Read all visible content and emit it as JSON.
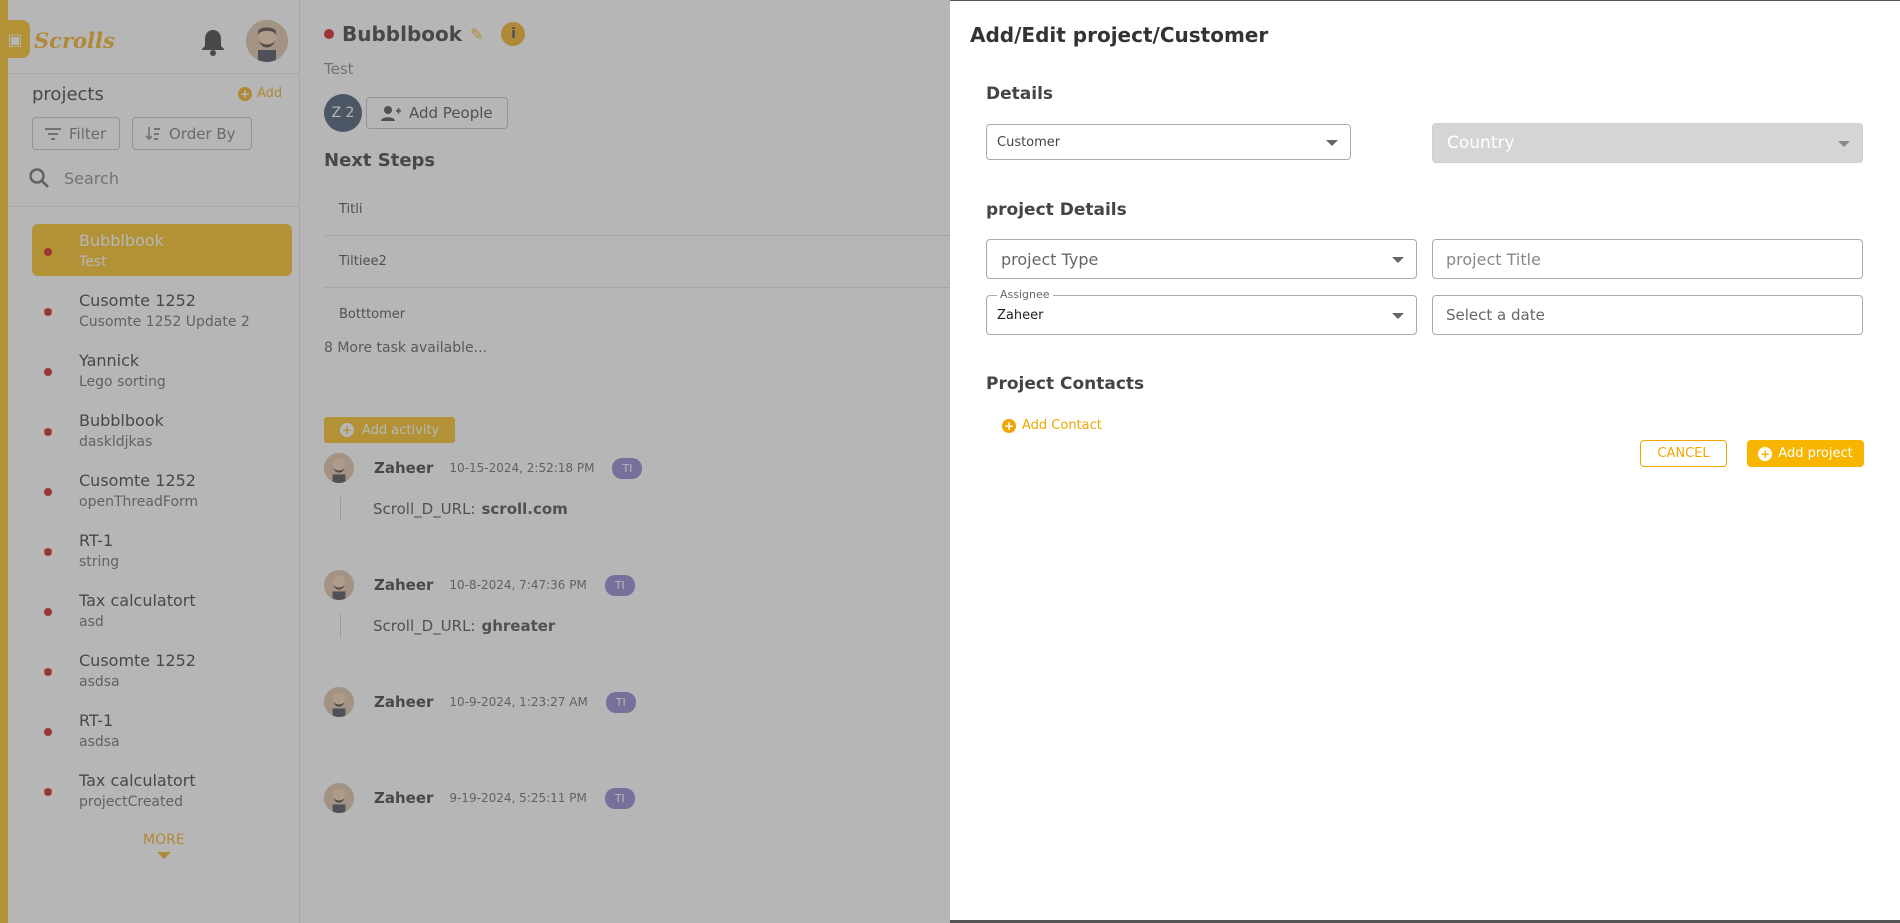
{
  "sidebar": {
    "logo": "Scrolls",
    "title": "projects",
    "add_label": "Add",
    "filter_label": "Filter",
    "order_label": "Order By",
    "search_placeholder": "Search",
    "more_label": "MORE",
    "items": [
      {
        "name": "Bubblbook",
        "sub": "Test"
      },
      {
        "name": "Cusomte 1252",
        "sub": "Cusomte 1252 Update 2"
      },
      {
        "name": "Yannick",
        "sub": "Lego sorting"
      },
      {
        "name": "Bubblbook",
        "sub": "daskldjkas"
      },
      {
        "name": "Cusomte 1252",
        "sub": "openThreadForm"
      },
      {
        "name": "RT-1",
        "sub": "string"
      },
      {
        "name": "Tax calculatort",
        "sub": "asd"
      },
      {
        "name": "Cusomte 1252",
        "sub": "asdsa"
      },
      {
        "name": "RT-1",
        "sub": "asdsa"
      },
      {
        "name": "Tax calculatort",
        "sub": "projectCreated"
      }
    ]
  },
  "main": {
    "title": "Bubblbook",
    "subtitle": "Test",
    "people_badge": "Z 2",
    "add_people_label": "Add People",
    "next_steps_title": "Next Steps",
    "tasks": [
      "Titli",
      "Tiltiee2",
      "Botttomer"
    ],
    "more_tasks": "8 More task available...",
    "add_activity_label": "Add activity",
    "activities": [
      {
        "user": "Zaheer",
        "time": "10-15-2024, 2:52:18 PM",
        "tag": "TI",
        "field": "Scroll_D_URL:",
        "value": "scroll.com"
      },
      {
        "user": "Zaheer",
        "time": "10-8-2024, 7:47:36 PM",
        "tag": "TI",
        "field": "Scroll_D_URL:",
        "value": "ghreater"
      },
      {
        "user": "Zaheer",
        "time": "10-9-2024, 1:23:27 AM",
        "tag": "TI"
      },
      {
        "user": "Zaheer",
        "time": "9-19-2024, 5:25:11 PM",
        "tag": "TI"
      }
    ]
  },
  "panel": {
    "title": "Add/Edit project/Customer",
    "details_heading": "Details",
    "customer_value": "Customer",
    "country_placeholder": "Country",
    "project_details_heading": "project Details",
    "project_type_placeholder": "project Type",
    "project_title_placeholder": "project Title",
    "assignee_label": "Assignee",
    "assignee_value": "Zaheer",
    "date_placeholder": "Select a date",
    "contacts_heading": "Project Contacts",
    "add_contact_label": "Add Contact",
    "cancel_label": "CANCEL",
    "add_project_label": "Add project"
  },
  "colors": {
    "accent": "#f7b500",
    "status_dot": "#cc0000",
    "tag": "#7f74c6",
    "overlay": "rgba(110,110,110,0.5)"
  }
}
